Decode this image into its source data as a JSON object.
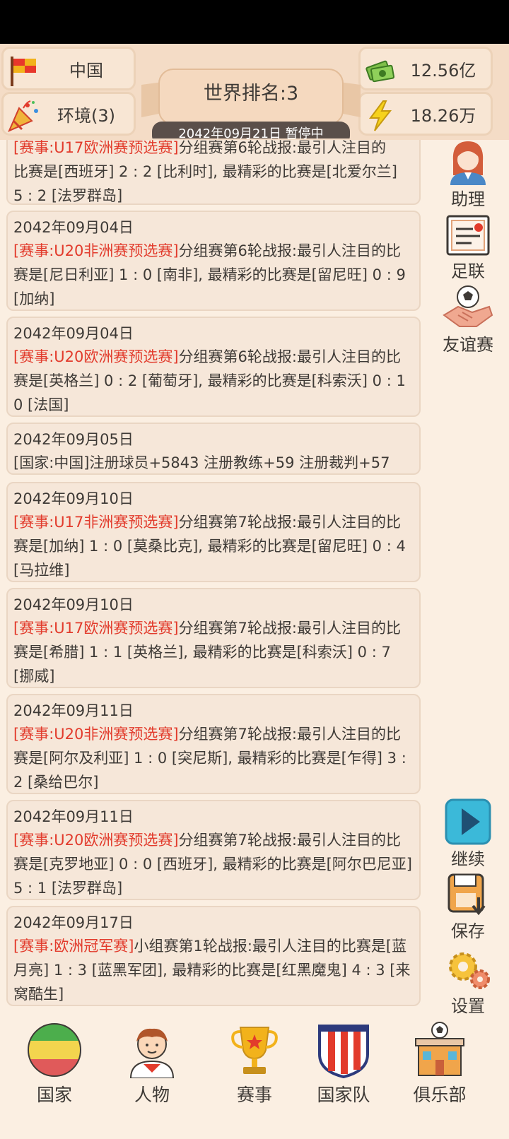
{
  "header": {
    "country": "中国",
    "environment": "环境(3)",
    "money": "12.56亿",
    "energy": "18.26万",
    "rank_title": "世界排名:3",
    "date_status": "2042年09月21日 暂停中"
  },
  "feed": {
    "partial_card": {
      "tag": "[赛事:U17欧洲赛预选赛]",
      "text": "分组赛第6轮战报:最引人注目的",
      "line2": "比赛是[西班牙] 2 : 2 [比利时], 最精彩的比赛是[北爱尔兰]",
      "line3": "5 : 2 [法罗群岛]"
    },
    "cards": [
      {
        "date": "2042年09月04日",
        "tag": "[赛事:U20非洲赛预选赛]",
        "text": "分组赛第6轮战报:最引人注目的比赛是[尼日利亚] 1 : 0 [南非], 最精彩的比赛是[留尼旺] 0 : 9 [加纳]"
      },
      {
        "date": "2042年09月04日",
        "tag": "[赛事:U20欧洲赛预选赛]",
        "text": "分组赛第6轮战报:最引人注目的比赛是[英格兰] 0 : 2 [葡萄牙], 最精彩的比赛是[科索沃] 0 : 10 [法国]"
      },
      {
        "date": "2042年09月05日",
        "tag": "",
        "text": "[国家:中国]注册球员+5843 注册教练+59 注册裁判+57"
      },
      {
        "date": "2042年09月10日",
        "tag": "[赛事:U17非洲赛预选赛]",
        "text": "分组赛第7轮战报:最引人注目的比赛是[加纳] 1 : 0 [莫桑比克], 最精彩的比赛是[留尼旺] 0 : 4 [马拉维]"
      },
      {
        "date": "2042年09月10日",
        "tag": "[赛事:U17欧洲赛预选赛]",
        "text": "分组赛第7轮战报:最引人注目的比赛是[希腊] 1 : 1 [英格兰], 最精彩的比赛是[科索沃] 0 : 7 [挪威]"
      },
      {
        "date": "2042年09月11日",
        "tag": "[赛事:U20非洲赛预选赛]",
        "text": "分组赛第7轮战报:最引人注目的比赛是[阿尔及利亚] 1 : 0 [突尼斯], 最精彩的比赛是[乍得] 3 : 2 [桑给巴尔]"
      },
      {
        "date": "2042年09月11日",
        "tag": "[赛事:U20欧洲赛预选赛]",
        "text": "分组赛第7轮战报:最引人注目的比赛是[克罗地亚] 0 : 0 [西班牙], 最精彩的比赛是[阿尔巴尼亚] 5 : 1 [法罗群岛]"
      },
      {
        "date": "2042年09月17日",
        "tag": "[赛事:欧洲冠军赛]",
        "text": "小组赛第1轮战报:最引人注目的比赛是[蓝月亮] 1 : 3 [蓝黑军团], 最精彩的比赛是[红黑魔鬼] 4 : 3 [来窝酷生]"
      }
    ]
  },
  "side": {
    "assistant": "助理",
    "federation": "足联",
    "friendly": "友谊赛",
    "continue": "继续",
    "save": "保存",
    "settings": "设置"
  },
  "nav": {
    "country": "国家",
    "people": "人物",
    "events": "赛事",
    "national_team": "国家队",
    "club": "俱乐部"
  },
  "colors": {
    "accent_red": "#e23b2c",
    "background": "#fbefe2",
    "card": "#f6e7d9",
    "play_button": "#3bb9d9"
  }
}
